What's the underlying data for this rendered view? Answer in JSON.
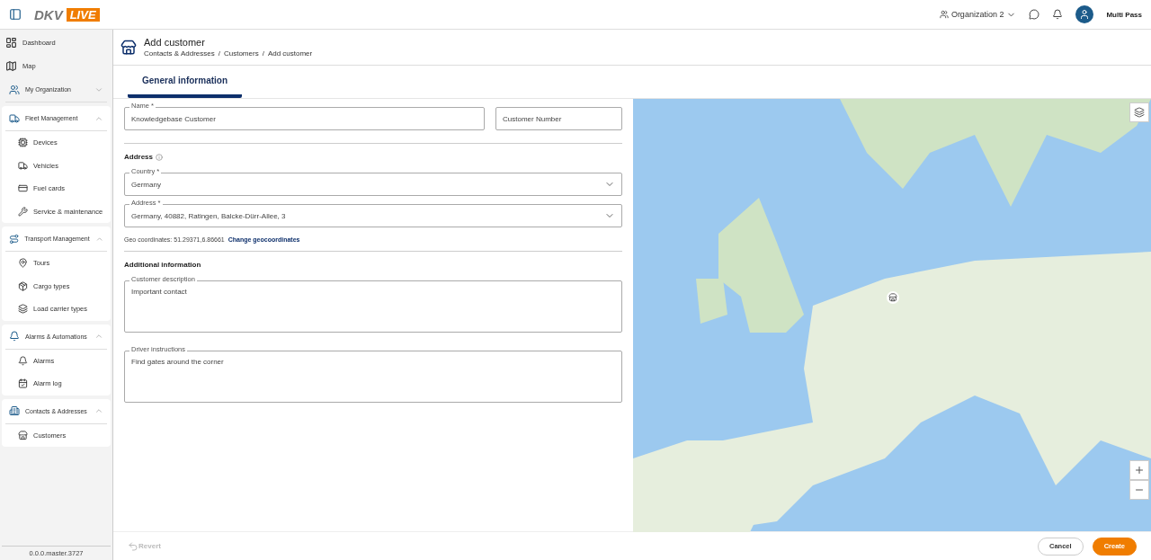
{
  "header": {
    "logo": {
      "brand": "DKV",
      "badge": "LIVE"
    },
    "organization": "Organization 2",
    "user": "Multi Pass"
  },
  "sidebar": {
    "sections": [
      {
        "kind": "link",
        "label": "Dashboard",
        "selected": false
      },
      {
        "kind": "link",
        "label": "Map",
        "selected": false
      },
      {
        "kind": "group",
        "label": "My Organization",
        "expanded": false
      },
      {
        "kind": "group",
        "label": "Fleet Management",
        "expanded": true,
        "children": [
          {
            "label": "Devices",
            "selected": false
          },
          {
            "label": "Vehicles",
            "selected": false
          },
          {
            "label": "Fuel cards",
            "selected": false
          },
          {
            "label": "Service & maintenance",
            "selected": false
          }
        ]
      },
      {
        "kind": "group",
        "label": "Transport Management",
        "expanded": true,
        "children": [
          {
            "label": "Tours",
            "selected": false
          },
          {
            "label": "Cargo types",
            "selected": false
          },
          {
            "label": "Load carrier types",
            "selected": false
          }
        ]
      },
      {
        "kind": "group",
        "label": "Alarms & Automations",
        "expanded": true,
        "children": [
          {
            "label": "Alarms",
            "selected": false
          },
          {
            "label": "Alarm log",
            "selected": false
          }
        ]
      },
      {
        "kind": "group",
        "label": "Contacts & Addresses",
        "expanded": true,
        "children": [
          {
            "label": "Customers",
            "selected": false
          }
        ]
      }
    ],
    "version": "0.0.0.master.3727"
  },
  "page": {
    "title": "Add customer",
    "breadcrumbs": [
      "Contacts & Addresses",
      "Customers",
      "Add customer"
    ],
    "breadcrumb_separator": "/"
  },
  "tabs": [
    {
      "label": "General information",
      "selected": true
    }
  ],
  "form": {
    "name": {
      "label": "Name *",
      "value": "Knowledgebase Customer"
    },
    "customer_number": {
      "placeholder": "Customer Number"
    },
    "address_heading": "Address",
    "country": {
      "label": "Country *",
      "value": "Germany"
    },
    "address": {
      "label": "Address *",
      "value": "Germany, 40882, Ratingen, Balcke-Dürr-Allee, 3"
    },
    "geo_coordinates": "Geo coordinates: 51.29371,6.86661",
    "change_link": "Change geocoordinates",
    "additional_heading": "Additional information",
    "description": {
      "label": "Customer description",
      "value": "Important contact"
    },
    "driver_instructions": {
      "label": "Driver instructions",
      "value": "Find gates around the corner"
    }
  },
  "footer": {
    "revert": {
      "label": "Revert",
      "disabled": true
    },
    "cancel": "Cancel",
    "create": "Create"
  }
}
